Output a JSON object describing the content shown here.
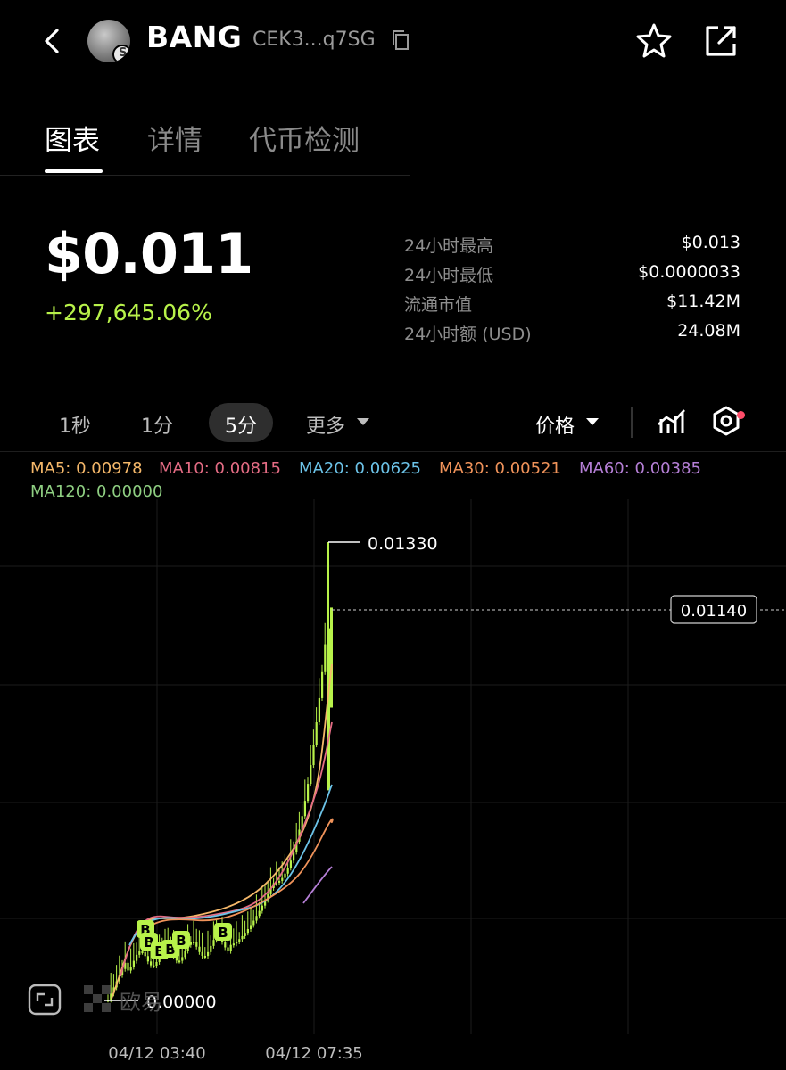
{
  "header": {
    "token_name": "BANG",
    "token_address": "CEK3...q7SG"
  },
  "tabs": [
    {
      "label": "图表",
      "active": true
    },
    {
      "label": "详情",
      "active": false
    },
    {
      "label": "代币检测",
      "active": false
    }
  ],
  "price": {
    "current": "$0.011",
    "change": "+297,645.06%"
  },
  "stats": [
    {
      "label": "24小时最高",
      "value": "$0.013"
    },
    {
      "label": "24小时最低",
      "value": "$0.0000033"
    },
    {
      "label": "流通市值",
      "value": "$11.42M"
    },
    {
      "label": "24小时额 (USD)",
      "value": "24.08M"
    }
  ],
  "timeframes": {
    "items": [
      "1秒",
      "1分",
      "5分"
    ],
    "active": "5分",
    "more": "更多",
    "price_mode": "价格"
  },
  "ma_legend": [
    {
      "label": "MA5: 0.00978",
      "color": "#f5b86a"
    },
    {
      "label": "MA10: 0.00815",
      "color": "#e46c84"
    },
    {
      "label": "MA20: 0.00625",
      "color": "#6cc3e8"
    },
    {
      "label": "MA30: 0.00521",
      "color": "#f0935a"
    },
    {
      "label": "MA60: 0.00385",
      "color": "#b57fd6"
    },
    {
      "label": "MA120: 0.00000",
      "color": "#8fcf82"
    }
  ],
  "chart_annotations": {
    "high_label": "0.01330",
    "current_price_label": "0.01140",
    "low_label": "0.00000",
    "watermark": "欧易",
    "buy_marker": "B"
  },
  "chart_data": {
    "type": "line",
    "x_tick_labels": [
      "04/12 03:40",
      "04/12 07:35"
    ],
    "high": 0.0133,
    "current": 0.0114,
    "low": 0.0,
    "series": [
      {
        "name": "MA5",
        "value": 0.00978
      },
      {
        "name": "MA10",
        "value": 0.00815
      },
      {
        "name": "MA20",
        "value": 0.00625
      },
      {
        "name": "MA30",
        "value": 0.00521
      },
      {
        "name": "MA60",
        "value": 0.00385
      },
      {
        "name": "MA120",
        "value": 0.0
      }
    ]
  },
  "colors": {
    "up": "#b8f24a",
    "background": "#000000",
    "accent_red": "#ff4d6a"
  }
}
